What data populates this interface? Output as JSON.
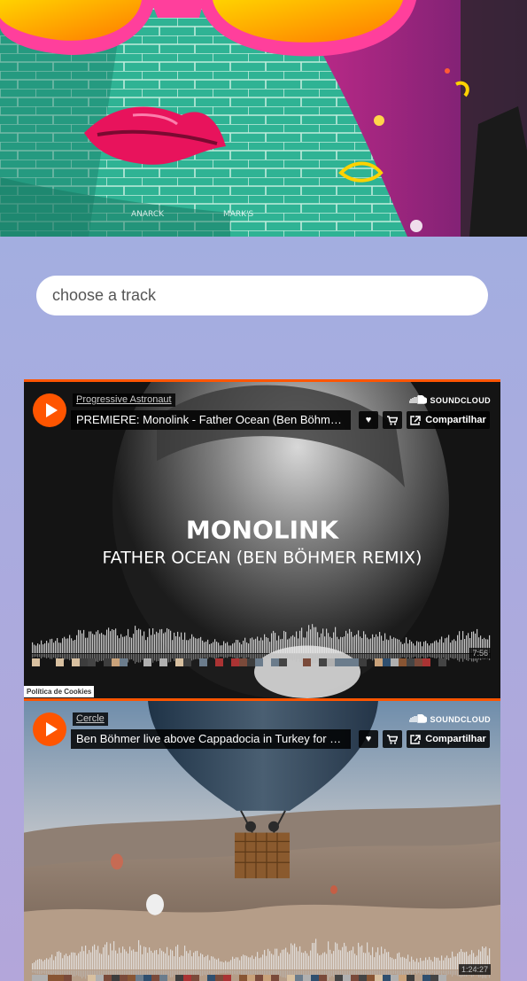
{
  "search": {
    "placeholder": "choose a track"
  },
  "widgets": [
    {
      "user": "Progressive Astronaut",
      "title": "PREMIERE: Monolink - Father Ocean (Ben Böhmer Remix)",
      "art_artist": "MONOLINK",
      "art_title": "FATHER OCEAN (BEN BÖHMER REMIX)",
      "duration": "7:56"
    },
    {
      "user": "Cercle",
      "title": "Ben Böhmer live above Cappadocia in Turkey for Cercle",
      "duration": "1:24:27"
    }
  ],
  "soundcloud": {
    "logo": "SOUNDCLOUD",
    "share_label": "Compartilhar"
  },
  "cookie_label": "Política de Cookies",
  "hero": {
    "signature_left": "ANARCK",
    "signature_right": "MARK'S"
  },
  "colors": {
    "accent": "#ff5500",
    "background_top": "#9db0e2",
    "background_bottom": "#b3a6da"
  }
}
